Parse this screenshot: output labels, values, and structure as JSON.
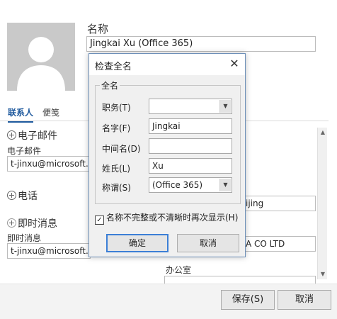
{
  "contact": {
    "name_label": "名称",
    "name_value": "Jingkai Xu (Office 365)"
  },
  "tabs": {
    "contacts": "联系人",
    "notes": "便笺"
  },
  "email": {
    "section": "电子邮件",
    "field_label": "电子邮件",
    "value": "t-jinxu@microsoft.c"
  },
  "phone": {
    "section": "电话"
  },
  "im": {
    "section": "即时消息",
    "field_label": "即时消息",
    "value": "t-jinxu@microsoft.c"
  },
  "right_fields": {
    "city_value": "ijing",
    "company_value": "A CO LTD",
    "office_label": "办公室"
  },
  "footer": {
    "save": "保存(S)",
    "cancel": "取消"
  },
  "dialog": {
    "title": "检查全名",
    "group_label": "全名",
    "title_field_label": "职务(T)",
    "title_field_value": "",
    "first_label": "名字(F)",
    "first_value": "Jingkai",
    "middle_label": "中间名(D)",
    "middle_value": "",
    "last_label": "姓氏(L)",
    "last_value": "Xu",
    "suffix_label": "称谓(S)",
    "suffix_value": "(Office 365)",
    "checkbox_label": "名称不完整或不清晰时再次显示(H)",
    "checkbox_checked": true,
    "ok": "确定",
    "cancel": "取消"
  },
  "colors": {
    "accent": "#1f5a9e",
    "dialog_border": "#6d8fb8",
    "ok_border": "#3c7fd6"
  }
}
